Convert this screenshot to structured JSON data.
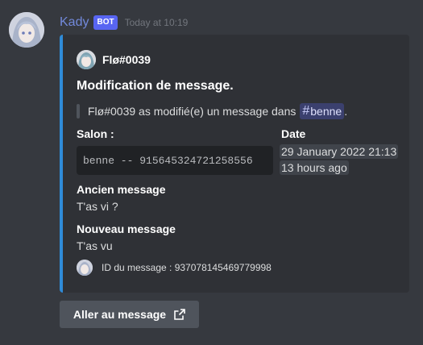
{
  "message": {
    "username": "Kady",
    "bot_tag": "BOT",
    "timestamp": "Today at 10:19",
    "avatar_icon": "anime-girl-avatar"
  },
  "embed": {
    "accent_color": "#2f8bd8",
    "author": {
      "name": "Flø#0039",
      "icon": "anime-avatar-icon"
    },
    "title": "Modification de message.",
    "description": {
      "prefix": "Flø#0039 as modifié(e) un message dans",
      "channel_hash": "#",
      "channel_name": "benne",
      "suffix": "."
    },
    "fields": {
      "salon": {
        "name": "Salon :",
        "value": "benne -- 915645324721258556"
      },
      "date": {
        "name": "Date",
        "value_line1": "29 January 2022 21:13",
        "value_line2": "13 hours ago"
      },
      "ancien": {
        "name": "Ancien message",
        "value": "T'as vi ?"
      },
      "nouveau": {
        "name": "Nouveau message",
        "value": "T'as vu"
      }
    },
    "footer": {
      "text": "ID du message : 937078145469779998",
      "icon": "footer-avatar-icon"
    }
  },
  "button": {
    "label": "Aller au message",
    "icon": "external-link-icon"
  },
  "colors": {
    "background": "#36393f",
    "embed_bg": "#2f3136",
    "username": "#7289da",
    "bot_tag": "#5865f2"
  }
}
